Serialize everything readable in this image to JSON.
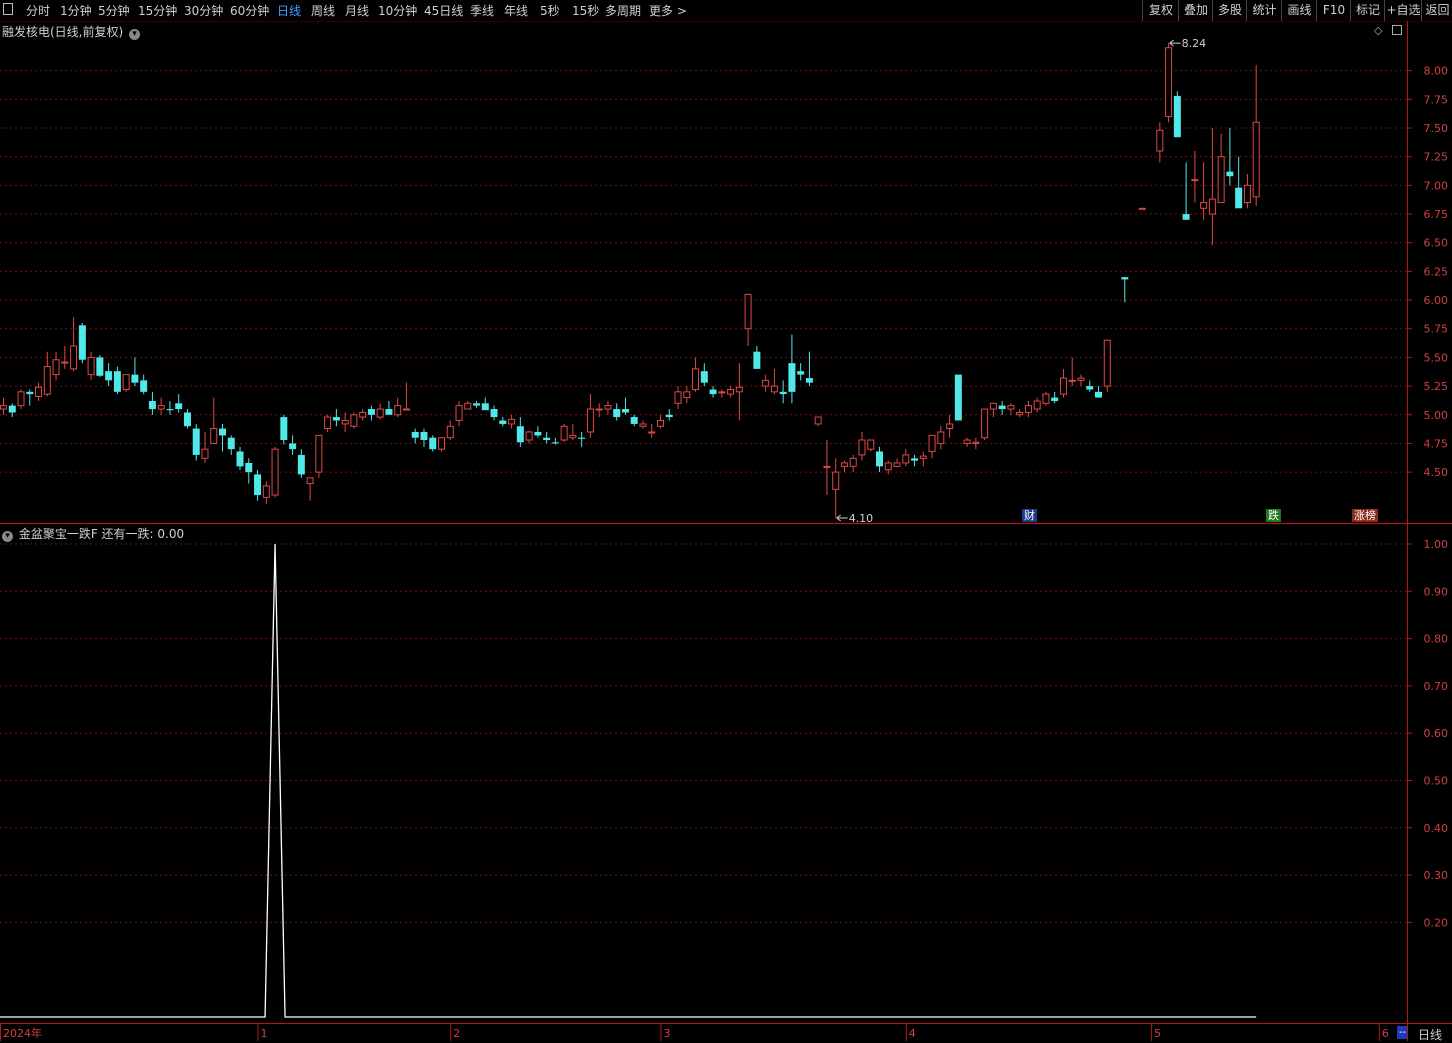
{
  "toolbar": {
    "left": [
      "分时",
      "1分钟",
      "5分钟",
      "15分钟",
      "30分钟",
      "60分钟",
      "日线",
      "周线",
      "月线",
      "10分钟",
      "45日线",
      "季线",
      "年线",
      "5秒",
      "15秒",
      "多周期",
      "更多 >"
    ],
    "active_label": "日线",
    "right": [
      "复权",
      "叠加",
      "多股",
      "统计",
      "画线",
      "F10",
      "标记",
      "+自选",
      "返回"
    ]
  },
  "main_panel": {
    "title": "融发核电(日线,前复权)"
  },
  "indicator_panel": {
    "title": "金盆聚宝一跌F  还有一跌: 0.00"
  },
  "badges": {
    "fin": "财",
    "drop": "跌",
    "rank": "涨榜"
  },
  "bottom": {
    "period_label": "日线",
    "corner_label": "--"
  },
  "colors": {
    "up": "#e04848",
    "down": "#50e8e8",
    "grid": "#7a1010",
    "line": "#ffffff"
  },
  "chart_data": [
    {
      "type": "candlestick",
      "title": "融发核电(日线,前复权)",
      "ylim": [
        4.1,
        8.25
      ],
      "yticks": [
        "8.00",
        "7.75",
        "7.50",
        "7.25",
        "7.00",
        "6.75",
        "6.50",
        "6.25",
        "6.00",
        "5.75",
        "5.50",
        "5.25",
        "5.00",
        "4.75",
        "4.50"
      ],
      "ytick_values": [
        8.0,
        7.75,
        7.5,
        7.25,
        7.0,
        6.75,
        6.5,
        6.25,
        6.0,
        5.75,
        5.5,
        5.25,
        5.0,
        4.75,
        4.5
      ],
      "annotations": [
        {
          "label": "8.24",
          "value": 8.24
        },
        {
          "label": "4.10",
          "value": 4.1
        }
      ],
      "ohlc": [
        [
          5.05,
          5.15,
          5.0,
          5.08
        ],
        [
          5.08,
          5.1,
          4.98,
          5.02
        ],
        [
          5.08,
          5.22,
          5.05,
          5.2
        ],
        [
          5.2,
          5.22,
          5.08,
          5.18
        ],
        [
          5.16,
          5.28,
          5.12,
          5.24
        ],
        [
          5.18,
          5.55,
          5.16,
          5.42
        ],
        [
          5.35,
          5.55,
          5.3,
          5.48
        ],
        [
          5.45,
          5.6,
          5.4,
          5.46
        ],
        [
          5.4,
          5.85,
          5.38,
          5.6
        ],
        [
          5.78,
          5.8,
          5.45,
          5.48
        ],
        [
          5.35,
          5.55,
          5.3,
          5.5
        ],
        [
          5.5,
          5.52,
          5.33,
          5.34
        ],
        [
          5.38,
          5.45,
          5.25,
          5.3
        ],
        [
          5.38,
          5.42,
          5.18,
          5.2
        ],
        [
          5.22,
          5.35,
          5.2,
          5.35
        ],
        [
          5.35,
          5.5,
          5.25,
          5.28
        ],
        [
          5.3,
          5.35,
          5.18,
          5.2
        ],
        [
          5.12,
          5.2,
          5.0,
          5.05
        ],
        [
          5.05,
          5.15,
          5.0,
          5.08
        ],
        [
          5.05,
          5.12,
          5.0,
          5.04
        ],
        [
          5.1,
          5.18,
          5.02,
          5.05
        ],
        [
          5.02,
          5.05,
          4.88,
          4.9
        ],
        [
          4.88,
          4.92,
          4.6,
          4.65
        ],
        [
          4.62,
          4.85,
          4.58,
          4.7
        ],
        [
          4.75,
          5.15,
          4.75,
          4.88
        ],
        [
          4.88,
          4.92,
          4.68,
          4.82
        ],
        [
          4.8,
          4.82,
          4.65,
          4.7
        ],
        [
          4.68,
          4.72,
          4.52,
          4.55
        ],
        [
          4.58,
          4.62,
          4.4,
          4.5
        ],
        [
          4.48,
          4.52,
          4.25,
          4.3
        ],
        [
          4.28,
          4.42,
          4.22,
          4.38
        ],
        [
          4.3,
          4.72,
          4.28,
          4.7
        ],
        [
          4.98,
          5.0,
          4.74,
          4.78
        ],
        [
          4.75,
          4.82,
          4.65,
          4.7
        ],
        [
          4.65,
          4.7,
          4.45,
          4.48
        ],
        [
          4.4,
          4.45,
          4.25,
          4.45
        ],
        [
          4.5,
          4.82,
          4.45,
          4.82
        ],
        [
          4.88,
          5.0,
          4.85,
          4.98
        ],
        [
          4.98,
          5.05,
          4.9,
          4.95
        ],
        [
          4.92,
          5.02,
          4.85,
          4.95
        ],
        [
          4.9,
          5.02,
          4.88,
          5.0
        ],
        [
          4.98,
          5.05,
          4.95,
          5.02
        ],
        [
          5.05,
          5.08,
          4.95,
          5.0
        ],
        [
          4.98,
          5.1,
          4.96,
          5.05
        ],
        [
          5.05,
          5.12,
          5.0,
          5.0
        ],
        [
          5.0,
          5.15,
          4.98,
          5.08
        ],
        [
          5.05,
          5.28,
          5.04,
          5.05
        ],
        [
          4.85,
          4.88,
          4.75,
          4.8
        ],
        [
          4.85,
          4.88,
          4.72,
          4.78
        ],
        [
          4.8,
          4.82,
          4.68,
          4.7
        ],
        [
          4.7,
          4.75,
          4.68,
          4.8
        ],
        [
          4.8,
          4.95,
          4.78,
          4.9
        ],
        [
          4.95,
          5.12,
          4.9,
          5.08
        ],
        [
          5.05,
          5.12,
          5.05,
          5.1
        ],
        [
          5.1,
          5.12,
          5.06,
          5.08
        ],
        [
          5.1,
          5.15,
          5.06,
          5.04
        ],
        [
          5.05,
          5.08,
          4.95,
          4.98
        ],
        [
          4.95,
          4.98,
          4.9,
          4.92
        ],
        [
          4.92,
          5.0,
          4.88,
          4.96
        ],
        [
          4.9,
          4.98,
          4.72,
          4.76
        ],
        [
          4.78,
          4.86,
          4.75,
          4.85
        ],
        [
          4.85,
          4.9,
          4.8,
          4.82
        ],
        [
          4.8,
          4.85,
          4.75,
          4.78
        ],
        [
          4.76,
          4.8,
          4.74,
          4.75
        ],
        [
          4.78,
          4.92,
          4.76,
          4.9
        ],
        [
          4.8,
          4.92,
          4.78,
          4.82
        ],
        [
          4.8,
          4.85,
          4.72,
          4.79
        ],
        [
          4.85,
          5.18,
          4.8,
          5.05
        ],
        [
          5.05,
          5.1,
          4.98,
          5.05
        ],
        [
          5.05,
          5.12,
          5.0,
          5.08
        ],
        [
          5.05,
          5.1,
          4.95,
          4.98
        ],
        [
          5.05,
          5.15,
          5.0,
          5.02
        ],
        [
          4.98,
          5.0,
          4.9,
          4.92
        ],
        [
          4.9,
          4.95,
          4.88,
          4.92
        ],
        [
          4.85,
          4.92,
          4.8,
          4.85
        ],
        [
          4.9,
          5.0,
          4.88,
          4.95
        ],
        [
          5.0,
          5.05,
          4.95,
          4.98
        ],
        [
          5.1,
          5.25,
          5.05,
          5.2
        ],
        [
          5.15,
          5.25,
          5.1,
          5.2
        ],
        [
          5.22,
          5.5,
          5.2,
          5.4
        ],
        [
          5.38,
          5.45,
          5.25,
          5.28
        ],
        [
          5.22,
          5.25,
          5.15,
          5.18
        ],
        [
          5.2,
          5.22,
          5.15,
          5.2
        ],
        [
          5.18,
          5.25,
          5.15,
          5.22
        ],
        [
          5.2,
          5.45,
          4.95,
          5.24
        ],
        [
          5.75,
          6.05,
          5.6,
          6.05
        ],
        [
          5.55,
          5.6,
          5.4,
          5.4
        ],
        [
          5.25,
          5.35,
          5.2,
          5.3
        ],
        [
          5.2,
          5.4,
          5.18,
          5.25
        ],
        [
          5.2,
          5.3,
          5.1,
          5.18
        ],
        [
          5.45,
          5.7,
          5.1,
          5.2
        ],
        [
          5.38,
          5.45,
          5.3,
          5.35
        ],
        [
          5.32,
          5.55,
          5.25,
          5.28
        ],
        [
          4.92,
          4.98,
          4.9,
          4.98
        ],
        [
          4.55,
          4.78,
          4.3,
          4.55
        ],
        [
          4.35,
          4.62,
          4.1,
          4.5
        ],
        [
          4.55,
          4.6,
          4.5,
          4.58
        ],
        [
          4.55,
          4.65,
          4.5,
          4.62
        ],
        [
          4.65,
          4.85,
          4.6,
          4.78
        ],
        [
          4.7,
          4.72,
          4.68,
          4.78
        ],
        [
          4.68,
          4.72,
          4.5,
          4.55
        ],
        [
          4.52,
          4.6,
          4.48,
          4.58
        ],
        [
          4.55,
          4.62,
          4.54,
          4.58
        ],
        [
          4.58,
          4.7,
          4.55,
          4.65
        ],
        [
          4.62,
          4.65,
          4.55,
          4.6
        ],
        [
          4.62,
          4.68,
          4.55,
          4.64
        ],
        [
          4.68,
          4.82,
          4.62,
          4.82
        ],
        [
          4.75,
          4.9,
          4.7,
          4.85
        ],
        [
          4.88,
          5.0,
          4.8,
          4.92
        ],
        [
          5.35,
          5.35,
          4.95,
          4.95
        ],
        [
          4.75,
          4.8,
          4.72,
          4.78
        ],
        [
          4.75,
          4.8,
          4.7,
          4.76
        ],
        [
          4.8,
          5.05,
          4.78,
          5.05
        ],
        [
          5.05,
          5.1,
          4.98,
          5.1
        ],
        [
          5.08,
          5.12,
          5.0,
          5.05
        ],
        [
          5.05,
          5.1,
          5.0,
          5.08
        ],
        [
          5.0,
          5.05,
          4.98,
          5.02
        ],
        [
          5.02,
          5.12,
          4.98,
          5.08
        ],
        [
          5.05,
          5.15,
          5.02,
          5.12
        ],
        [
          5.1,
          5.2,
          5.08,
          5.18
        ],
        [
          5.15,
          5.2,
          5.1,
          5.12
        ],
        [
          5.18,
          5.4,
          5.15,
          5.32
        ],
        [
          5.3,
          5.5,
          5.25,
          5.3
        ],
        [
          5.3,
          5.35,
          5.25,
          5.32
        ],
        [
          5.25,
          5.3,
          5.2,
          5.22
        ],
        [
          5.2,
          5.25,
          5.15,
          5.15
        ],
        [
          5.25,
          5.65,
          5.2,
          5.65
        ],
        [
          null,
          null,
          null,
          null
        ],
        [
          6.2,
          6.2,
          5.98,
          6.18
        ],
        [
          null,
          null,
          null,
          null
        ],
        [
          6.8,
          6.8,
          6.8,
          6.8
        ],
        [
          null,
          null,
          null,
          null
        ],
        [
          7.3,
          7.55,
          7.2,
          7.48
        ],
        [
          7.6,
          8.24,
          7.55,
          8.2
        ],
        [
          7.78,
          7.82,
          7.42,
          7.42
        ],
        [
          6.75,
          7.2,
          6.7,
          6.7
        ],
        [
          7.05,
          7.3,
          6.85,
          7.05
        ],
        [
          6.8,
          7.2,
          6.7,
          6.85
        ],
        [
          6.75,
          7.5,
          6.48,
          6.88
        ],
        [
          6.85,
          7.45,
          6.85,
          7.25
        ],
        [
          7.12,
          7.5,
          7.0,
          7.08
        ],
        [
          6.98,
          7.25,
          6.82,
          6.8
        ],
        [
          6.85,
          7.1,
          6.8,
          7.0
        ],
        [
          6.9,
          8.05,
          6.82,
          7.55
        ]
      ]
    },
    {
      "type": "line",
      "title": "金盆聚宝一跌F  还有一跌: 0.00",
      "ylim": [
        0,
        1.0
      ],
      "yticks": [
        "1.00",
        "0.90",
        "0.80",
        "0.70",
        "0.60",
        "0.50",
        "0.40",
        "0.30",
        "0.20"
      ],
      "ytick_values": [
        1.0,
        0.9,
        0.8,
        0.7,
        0.6,
        0.5,
        0.4,
        0.3,
        0.2
      ],
      "spike": {
        "value": 1.0,
        "index": 31
      },
      "baseline": 0
    }
  ],
  "x_axis": {
    "labels": [
      "2024年",
      "1",
      "2",
      "3",
      "4",
      "5",
      "6"
    ],
    "label_bar_index": [
      0,
      29,
      51,
      75,
      103,
      131,
      157
    ]
  }
}
